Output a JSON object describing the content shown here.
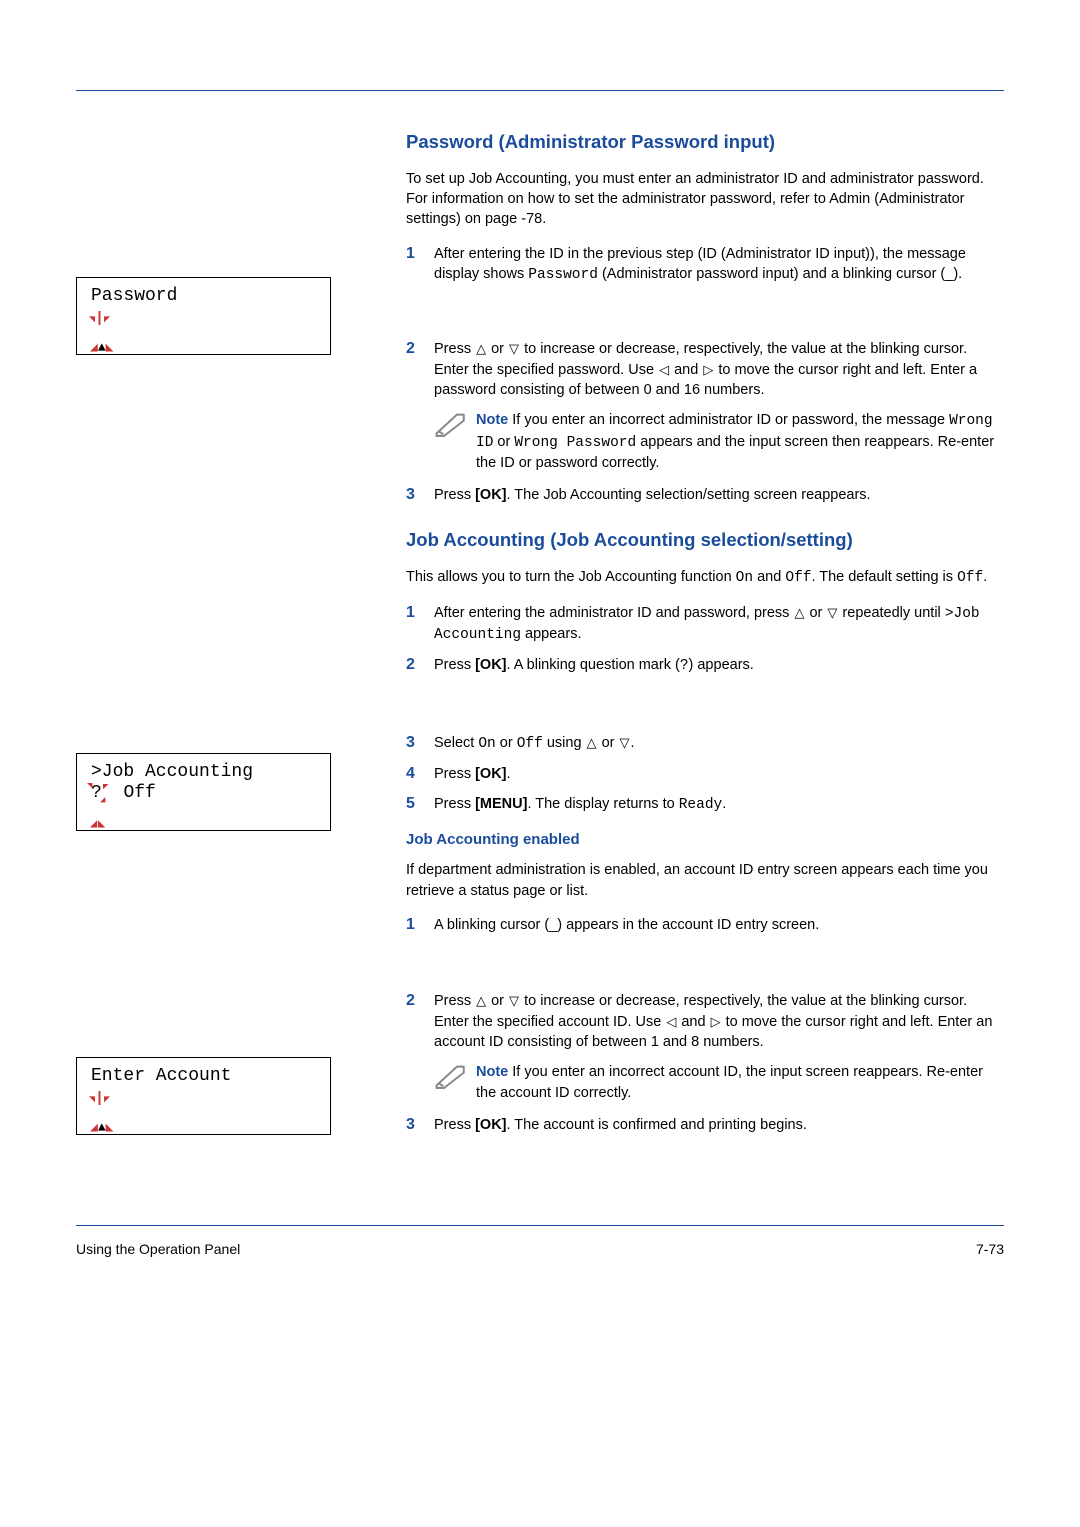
{
  "heading1": "Password (Administrator Password input)",
  "intro1": "To set up Job Accounting, you must enter an administrator ID and administrator password. For information on how to set the administrator password, refer to Admin (Administrator settings) on page -78.",
  "lcd1_line1": "Password",
  "steps1": {
    "s1_a": "After entering the ID in the previous step (ID (Administrator ID input)), the message display shows ",
    "s1_code": "Password",
    "s1_b": " (Administrator password input) and a blinking cursor (_).",
    "s2_a": "Press ",
    "s2_b": " or ",
    "s2_c": " to increase or decrease, respectively, the value at the blinking cursor. Enter the specified password. Use ",
    "s2_d": " and ",
    "s2_e": " to move the cursor right and left. Enter a password consisting of between 0 and 16 numbers.",
    "note1_label": "Note",
    "note1_a": "  If you enter an incorrect administrator ID or password, the message ",
    "note1_code1": "Wrong ID",
    "note1_mid": " or ",
    "note1_code2": "Wrong Password",
    "note1_b": " appears and the input screen then reappears. Re-enter the ID or password correctly.",
    "s3_a": "Press ",
    "s3_ok": "[OK]",
    "s3_b": ". The Job Accounting selection/setting screen reappears."
  },
  "heading2": "Job Accounting (Job Accounting selection/setting)",
  "intro2_a": "This allows you to turn the Job Accounting function ",
  "intro2_on": "On",
  "intro2_mid": " and ",
  "intro2_off": "Off",
  "intro2_b": ". The default setting is ",
  "intro2_off2": "Off",
  "intro2_c": ".",
  "lcd2_line1": ">Job Accounting",
  "lcd2_line2a": "?",
  "lcd2_line2b": "Off",
  "steps2": {
    "s1_a": "After entering the administrator ID and password, press ",
    "s1_b": " or ",
    "s1_c": " repeatedly until ",
    "s1_code": ">Job Accounting",
    "s1_d": " appears.",
    "s2_a": "Press ",
    "s2_ok": "[OK]",
    "s2_b": ". A blinking question mark (",
    "s2_q": "?",
    "s2_c": ") appears.",
    "s3_a": "Select ",
    "s3_on": "On",
    "s3_mid": " or ",
    "s3_off": "Off",
    "s3_b": " using ",
    "s3_c": " or ",
    "s3_d": ".",
    "s4_a": "Press ",
    "s4_ok": "[OK]",
    "s4_b": ".",
    "s5_a": "Press ",
    "s5_menu": "[MENU]",
    "s5_b": ". The display returns to ",
    "s5_ready": "Ready",
    "s5_c": "."
  },
  "heading3": "Job Accounting enabled",
  "intro3": "If department administration is enabled, an account ID entry screen appears each time you retrieve a status page or list.",
  "lcd3_line1": "Enter Account",
  "steps3": {
    "s1": "A blinking cursor (_) appears in the account ID entry screen.",
    "s2_a": "Press ",
    "s2_b": " or ",
    "s2_c": " to increase or decrease, respectively, the value at the blinking cursor. Enter the specified account ID. Use ",
    "s2_d": " and ",
    "s2_e": " to move the cursor right and left. Enter an account ID consisting of between 1 and 8 numbers.",
    "note2_label": "Note",
    "note2": "  If you enter an incorrect account ID, the input screen reappears. Re-enter the account ID correctly.",
    "s3_a": "Press ",
    "s3_ok": "[OK]",
    "s3_b": ". The account is confirmed and printing begins."
  },
  "footer_left": "Using the Operation Panel",
  "footer_right": "7-73"
}
